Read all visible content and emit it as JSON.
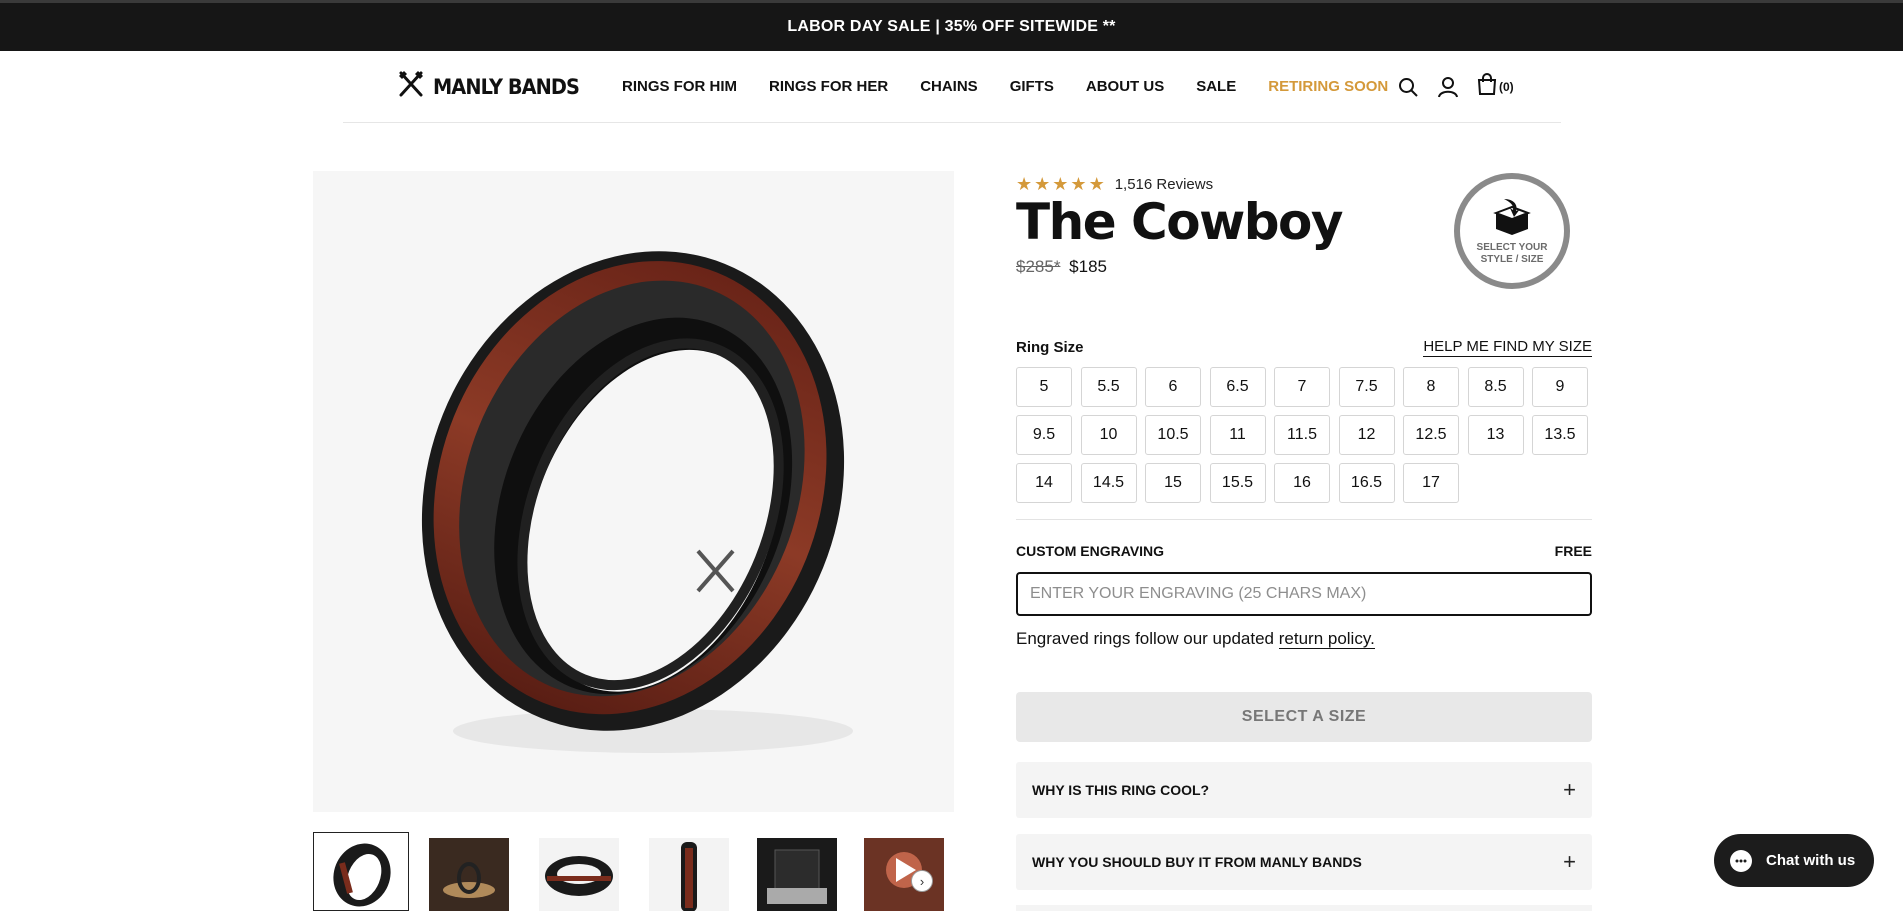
{
  "announcement": {
    "text": "LABOR DAY SALE | 35% OFF SITEWIDE **"
  },
  "header": {
    "logo_text": "MANLY BANDS",
    "nav": [
      {
        "label": "RINGS FOR HIM",
        "accent": false
      },
      {
        "label": "RINGS FOR HER",
        "accent": false
      },
      {
        "label": "CHAINS",
        "accent": false
      },
      {
        "label": "GIFTS",
        "accent": false
      },
      {
        "label": "ABOUT US",
        "accent": false
      },
      {
        "label": "SALE",
        "accent": false
      },
      {
        "label": "RETIRING SOON",
        "accent": true
      }
    ],
    "icons": [
      "search-icon",
      "account-icon",
      "cart-icon"
    ],
    "cart_count": "(0)",
    "accent_color": "#d4993a"
  },
  "product": {
    "rating_stars": 5,
    "reviews": "1,516 Reviews",
    "title": "The Cowboy",
    "price_old": "$285*",
    "price_new": "$185",
    "badge_text": "SELECT YOUR STYLE / SIZE"
  },
  "size": {
    "label": "Ring Size",
    "help": "HELP ME FIND MY SIZE",
    "options": [
      "5",
      "5.5",
      "6",
      "6.5",
      "7",
      "7.5",
      "8",
      "8.5",
      "9",
      "9.5",
      "10",
      "10.5",
      "11",
      "11.5",
      "12",
      "12.5",
      "13",
      "13.5",
      "14",
      "14.5",
      "15",
      "15.5",
      "16",
      "16.5",
      "17"
    ]
  },
  "engraving": {
    "label": "CUSTOM ENGRAVING",
    "price": "FREE",
    "placeholder": "ENTER YOUR ENGRAVING (25 CHARS MAX)",
    "value": "",
    "note_prefix": "Engraved rings follow our updated ",
    "note_link": "return policy."
  },
  "cta": {
    "label": "SELECT A SIZE"
  },
  "accordions": [
    {
      "label": "WHY IS THIS RING COOL?"
    },
    {
      "label": "WHY YOU SHOULD BUY IT FROM MANLY BANDS"
    }
  ],
  "thumbnails": [
    "ring-front",
    "ring-lifestyle",
    "ring-side",
    "ring-edge",
    "ring-box",
    "ring-video"
  ],
  "chat": {
    "label": "Chat with us"
  }
}
